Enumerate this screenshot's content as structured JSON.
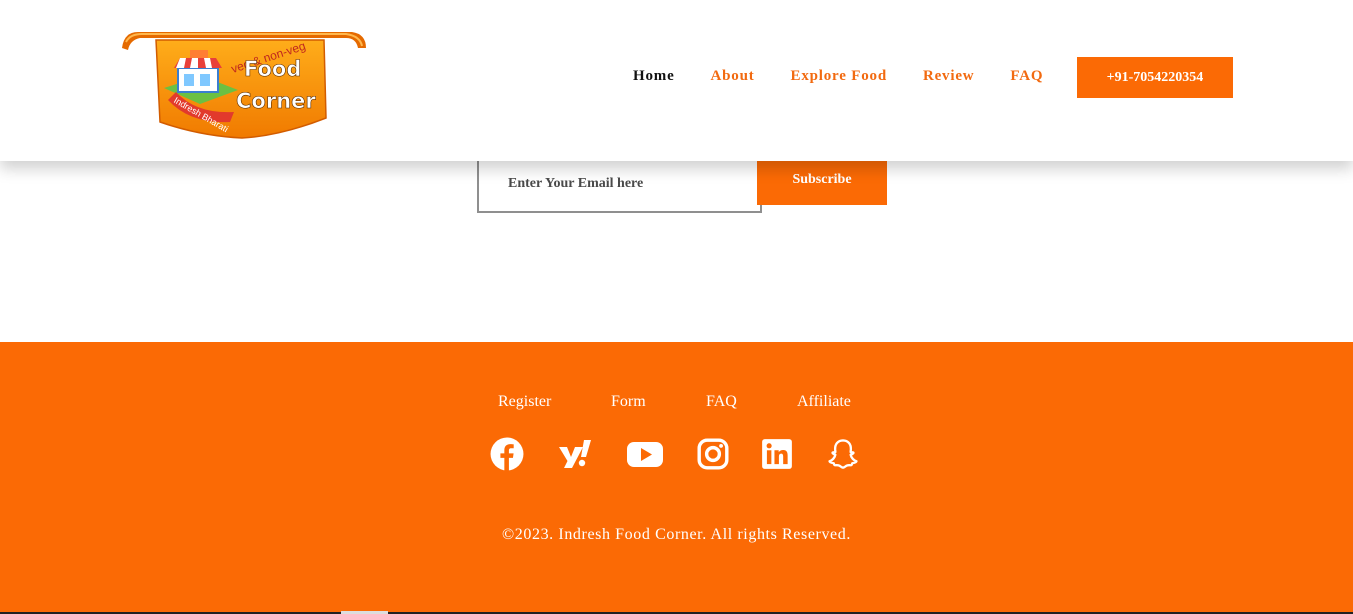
{
  "header": {
    "logo": {
      "top_text": "veg & non-veg",
      "line1": "Food",
      "line2": "Corner",
      "ribbon_text": "Indresh Bharati"
    },
    "nav": [
      {
        "label": "Home",
        "active": true
      },
      {
        "label": "About",
        "active": false
      },
      {
        "label": "Explore Food",
        "active": false
      },
      {
        "label": "Review",
        "active": false
      },
      {
        "label": "FAQ",
        "active": false
      }
    ],
    "phone_label": "+91-7054220354"
  },
  "subscribe": {
    "email_placeholder": "Enter Your Email here",
    "button_label": "Subscribe"
  },
  "footer": {
    "links": [
      "Register",
      "Form",
      "FAQ",
      "Affiliate"
    ],
    "social_icons": [
      "facebook-icon",
      "yelp-icon",
      "youtube-icon",
      "instagram-icon",
      "linkedin-icon",
      "snapchat-icon"
    ],
    "copyright": "©2023. Indresh Food Corner. All rights Reserved."
  },
  "colors": {
    "accent": "#fb6a05",
    "nav_link": "#f26a10",
    "nav_active": "#111111",
    "footer_text": "#ffffff"
  }
}
